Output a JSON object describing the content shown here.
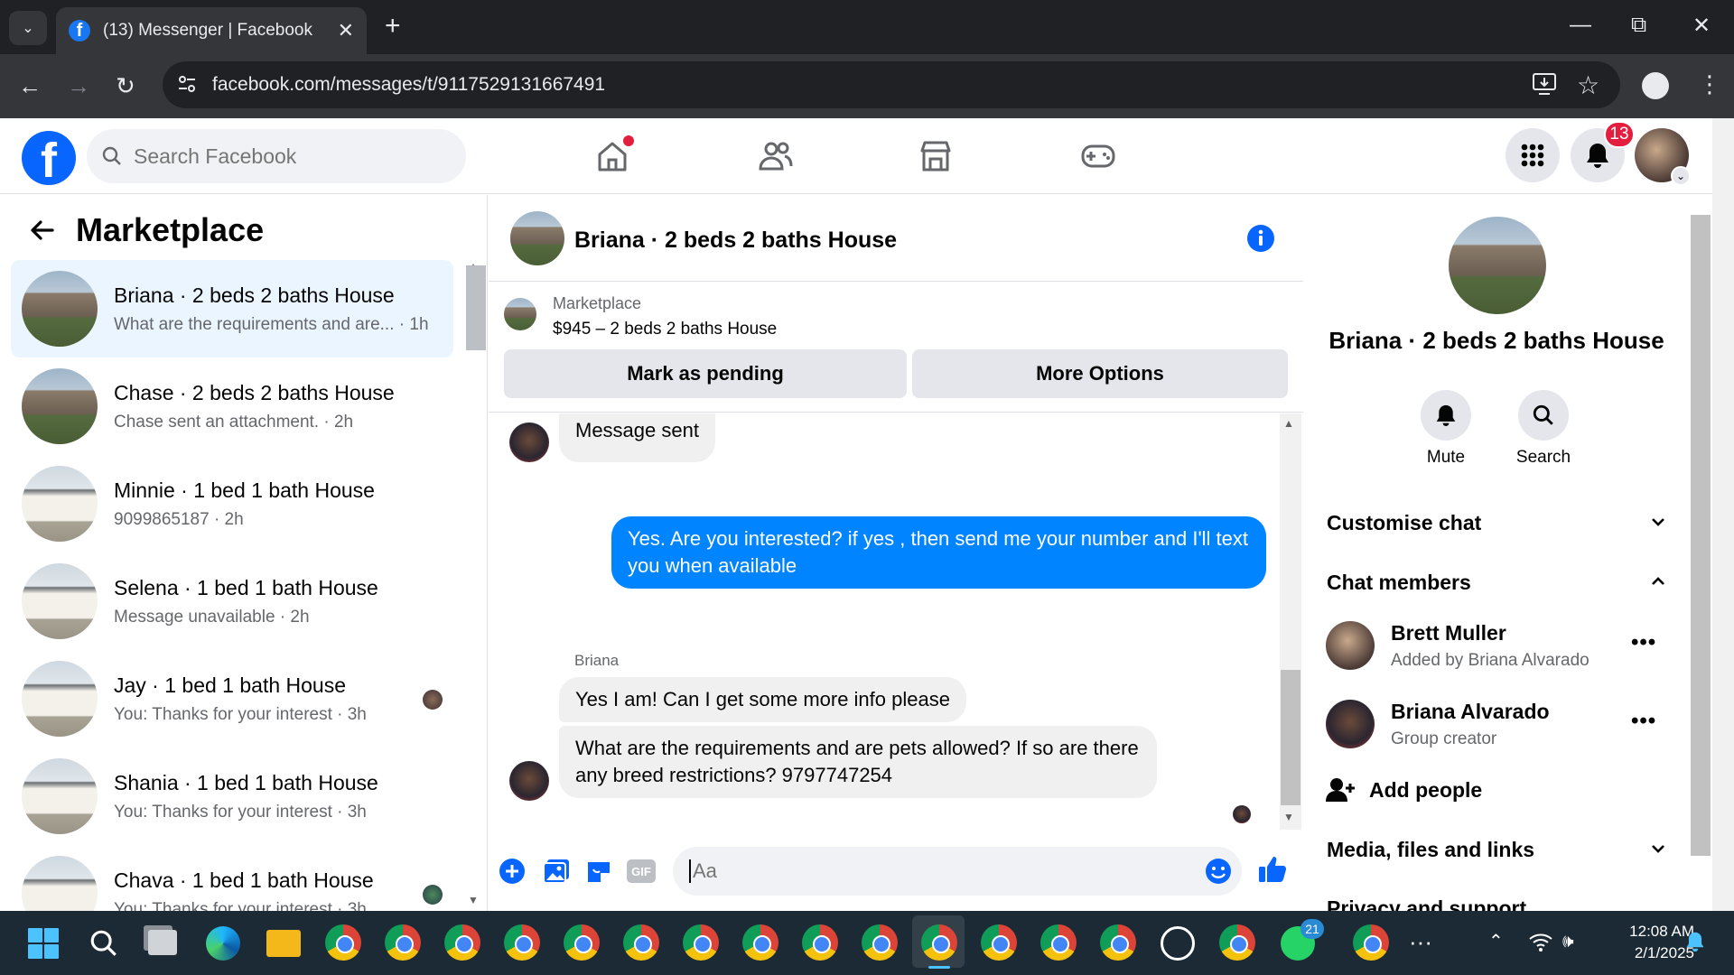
{
  "browser": {
    "tab_title": "(13) Messenger | Facebook",
    "url": "facebook.com/messages/t/9117529131667491"
  },
  "header": {
    "search_placeholder": "Search Facebook",
    "home_has_dot": true,
    "notifications_count": "13"
  },
  "sidebar": {
    "title": "Marketplace",
    "conversations": [
      {
        "name": "Briana · 2 beds 2 baths House",
        "preview": "What are the requirements and are... · 1h",
        "active": true
      },
      {
        "name": "Chase · 2 beds 2 baths House",
        "preview": "Chase sent an attachment. · 2h"
      },
      {
        "name": "Minnie · 1 bed 1 bath House",
        "preview": "9099865187 · 2h"
      },
      {
        "name": "Selena · 1 bed 1 bath House",
        "preview": "Message unavailable · 2h"
      },
      {
        "name": "Jay · 1 bed 1 bath House",
        "preview": "You: Thanks for your interest · 3h"
      },
      {
        "name": "Shania · 1 bed 1 bath House",
        "preview": "You: Thanks for your interest · 3h"
      },
      {
        "name": "Chava · 1 bed 1 bath House",
        "preview": "You: Thanks for your interest · 3h"
      }
    ]
  },
  "chat": {
    "title": "Briana · 2 beds 2 baths House",
    "listing_label": "Marketplace",
    "listing": "$945 – 2 beds 2 baths House",
    "mark_pending_label": "Mark as pending",
    "more_options_label": "More Options",
    "messages": [
      {
        "from": "them",
        "text": "Message sent"
      },
      {
        "from": "me",
        "text": "Yes. Are you interested? if yes , then send me your number and I'll text you when available"
      },
      {
        "from": "them",
        "sender": "Briana",
        "text": "Yes I am! Can I get some more info please"
      },
      {
        "from": "them",
        "text": "What are the requirements and are pets allowed? If so are there any breed restrictions? 9797747254"
      }
    ],
    "composer_placeholder": "Aa"
  },
  "details": {
    "name": "Briana · 2 beds 2 baths House",
    "mute_label": "Mute",
    "search_label": "Search",
    "customise_chat": "Customise chat",
    "chat_members": "Chat members",
    "members": [
      {
        "name": "Brett Muller",
        "sub": "Added by Briana Alvarado"
      },
      {
        "name": "Briana Alvarado",
        "sub": "Group creator"
      }
    ],
    "add_people": "Add people",
    "media": "Media, files and links",
    "privacy": "Privacy and support"
  },
  "taskbar": {
    "time": "12:08 AM",
    "date": "2/1/2025",
    "whatsapp_badge": "21"
  },
  "colors": {
    "fb_blue": "#0866ff",
    "messenger_blue": "#0084ff",
    "notification_red": "#e41e3f"
  }
}
